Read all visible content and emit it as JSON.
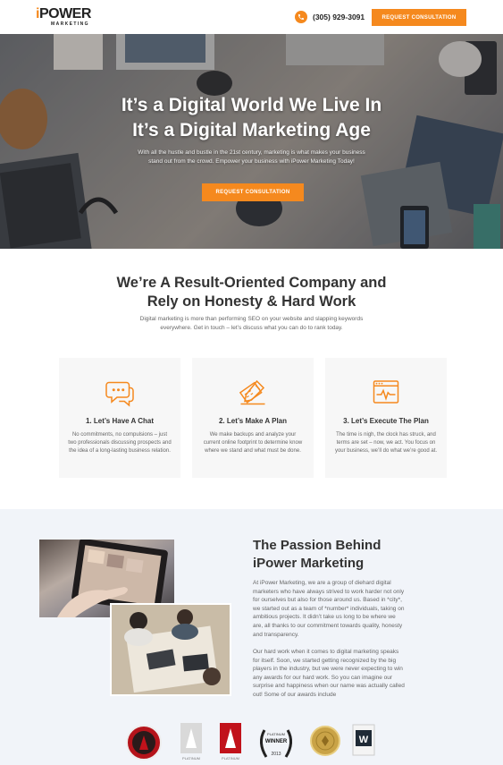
{
  "header": {
    "logo_i": "i",
    "logo_main": "POWER",
    "logo_sub": "MARKETING",
    "phone": "(305) 929-3091",
    "cta_label": "REQUEST CONSULTATION"
  },
  "hero": {
    "title_line1": "It’s a Digital World We Live In",
    "title_line2": "It’s a Digital Marketing Age",
    "subtitle": "With all the hustle and bustle in the 21st century, marketing is what makes your business stand out from the crowd. Empower your business with iPower Marketing Today!",
    "cta_label": "REQUEST CONSULTATION"
  },
  "result": {
    "title_line1": "We’re A Result-Oriented Company and",
    "title_line2": "Rely on Honesty & Hard Work",
    "description": "Digital marketing is more than performing SEO on your website and slapping keywords everywhere. Get in touch – let’s discuss what you can do to rank today."
  },
  "cards": [
    {
      "icon": "chat-icon",
      "title": "1. Let’s Have A Chat",
      "text": "No commitments, no compulsions – just two professionals discussing prospects and the idea of a long-lasting business relation."
    },
    {
      "icon": "plan-icon",
      "title": "2. Let’s Make A Plan",
      "text": "We make backups and analyze your current online footprint to determine know where we stand and what must be done."
    },
    {
      "icon": "execute-icon",
      "title": "3. Let’s Execute The Plan",
      "text": "The time is nigh, the clock has struck, and terms are set – now, we act. You focus on your business, we’ll do what we’re good at."
    }
  ],
  "passion": {
    "title_line1": "The Passion Behind",
    "title_line2": "iPower Marketing",
    "p1": "At iPower Marketing, we are a group of diehard digital marketers who have always strived to work harder not only for ourselves but also for those around us. Based in *city*, we started out as a team of *number* individuals, taking on ambitious projects. It didn’t take us long to be where we are, all thanks to our commitment towards quality, honesty and transparency.",
    "p2": "Our hard work when it comes to digital marketing speaks for itself. Soon, we started getting recognized by the big players in the industry, but we were never expecting to win any awards for our hard work. So you can imagine our surprise and happiness when our name was actually called out! Some of our awards include"
  },
  "awards": {
    "platinum_label": "PLATINUM",
    "winner_label": "WINNER",
    "year_label": "2013",
    "w_label": "W"
  },
  "colors": {
    "accent": "#f5891e",
    "text_dark": "#333333",
    "text_muted": "#666666",
    "card_bg": "#f7f7f7",
    "section_bg": "#f1f4f9"
  }
}
